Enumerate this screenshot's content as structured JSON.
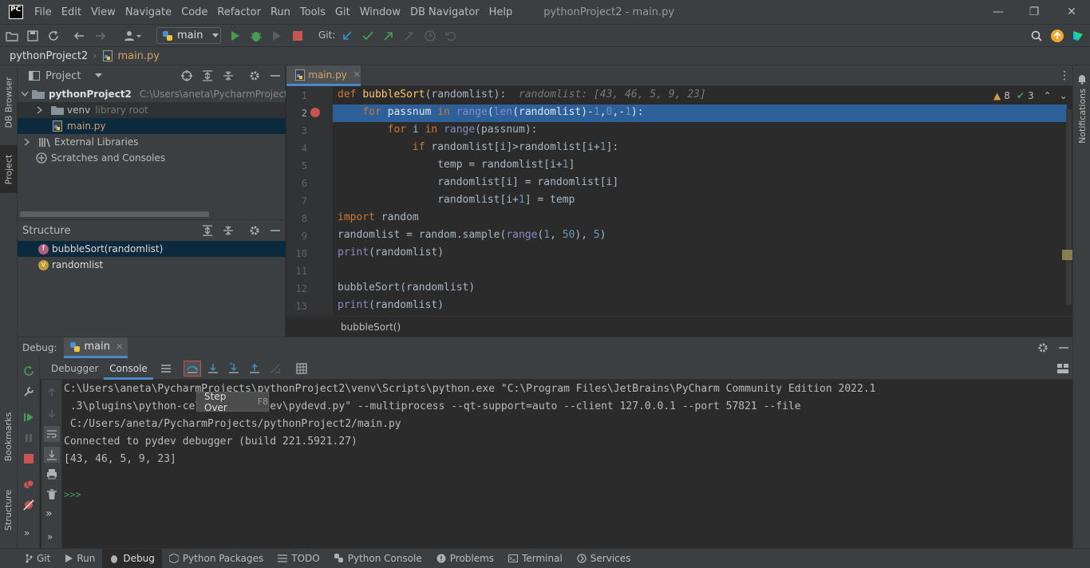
{
  "menubar": {
    "items": [
      "File",
      "Edit",
      "View",
      "Navigate",
      "Code",
      "Refactor",
      "Run",
      "Tools",
      "Git",
      "Window",
      "DB Navigator",
      "Help"
    ],
    "title": "pythonProject2 - main.py",
    "logo": "PC"
  },
  "toolbar": {
    "run_config": "main",
    "git_label": "Git:"
  },
  "breadcrumb": {
    "project": "pythonProject2",
    "file": "main.py"
  },
  "left_stripe": {
    "db_browser": "DB Browser",
    "project": "Project",
    "bookmarks": "Bookmarks",
    "structure": "Structure"
  },
  "right_stripe": {
    "notifications": "Notifications"
  },
  "project_panel": {
    "title": "Project",
    "root_name": "pythonProject2",
    "root_path": "C:\\Users\\aneta\\PycharmProjects\\pyt",
    "venv": "venv",
    "venv_note": "library root",
    "main_file": "main.py",
    "external": "External Libraries",
    "scratches": "Scratches and Consoles"
  },
  "structure_panel": {
    "title": "Structure",
    "items": [
      {
        "badge": "f",
        "label": "bubbleSort(randomlist)"
      },
      {
        "badge": "v",
        "label": "randomlist"
      }
    ]
  },
  "editor": {
    "tab": "main.py",
    "inspections": {
      "warnings": "8",
      "ok": "3"
    },
    "line_numbers": [
      "1",
      "2",
      "3",
      "4",
      "5",
      "6",
      "7",
      "8",
      "9",
      "10",
      "11",
      "12",
      "13"
    ],
    "inline_hint": "randomlist: [43, 46, 5, 9, 23]",
    "footer": "bubbleSort()"
  },
  "debug": {
    "label": "Debug:",
    "config": "main",
    "tabs": [
      "Debugger",
      "Console"
    ],
    "console_lines": [
      "C:\\Users\\aneta\\PycharmProjects\\pythonProject2\\venv\\Scripts\\python.exe \"C:\\Program Files\\JetBrains\\PyCharm Community Edition 2022.1",
      " .3\\plugins\\python-ce\\helpers\\pydev\\pydevd.py\" --multiprocess --qt-support=auto --client 127.0.0.1 --port 57821 --file",
      " C:/Users/aneta/PycharmProjects/pythonProject2/main.py",
      "Connected to pydev debugger (build 221.5921.27)",
      "[43, 46, 5, 9, 23]"
    ],
    "prompt": ">>>",
    "tooltip": {
      "label": "Step Over",
      "shortcut": "F8"
    }
  },
  "statusbar": {
    "tabs": [
      "Git",
      "Run",
      "Debug",
      "Python Packages",
      "TODO",
      "Python Console",
      "Problems",
      "Terminal",
      "Services"
    ]
  }
}
